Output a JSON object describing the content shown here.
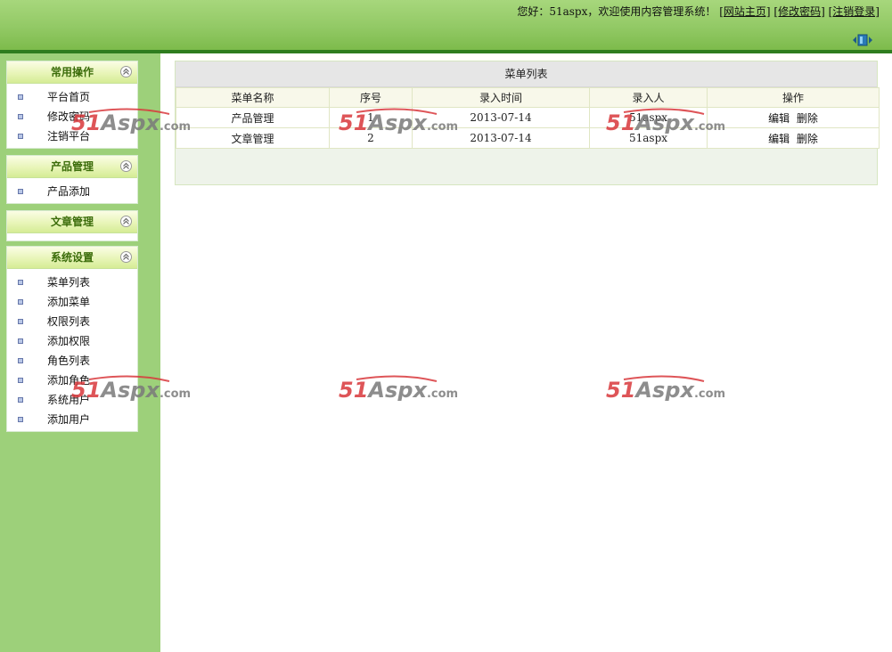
{
  "header": {
    "greeting_prefix": "您好：",
    "username": "51aspx",
    "greeting_suffix": "，欢迎使用内容管理系统！",
    "links": [
      "[网站主页]",
      "[修改密码]",
      "[注销登录]"
    ],
    "toggle_icon": "panel-toggle-icon"
  },
  "sidebar": {
    "groups": [
      {
        "title": "常用操作",
        "items": [
          "平台首页",
          "修改密码",
          "注销平台"
        ]
      },
      {
        "title": "产品管理",
        "items": [
          "产品添加"
        ]
      },
      {
        "title": "文章管理",
        "items": []
      },
      {
        "title": "系统设置",
        "items": [
          "菜单列表",
          "添加菜单",
          "权限列表",
          "添加权限",
          "角色列表",
          "添加角色",
          "系统用户",
          "添加用户"
        ]
      }
    ]
  },
  "main": {
    "title": "菜单列表",
    "columns": [
      "菜单名称",
      "序号",
      "录入时间",
      "录入人",
      "操作"
    ],
    "rows": [
      {
        "name": "产品管理",
        "order": "1",
        "date": "2013-07-14",
        "author": "51aspx",
        "edit": "编辑",
        "delete": "删除"
      },
      {
        "name": "文章管理",
        "order": "2",
        "date": "2013-07-14",
        "author": "51aspx",
        "edit": "编辑",
        "delete": "删除"
      }
    ]
  },
  "watermark": {
    "text_51": "51",
    "text_aspx": "Aspx",
    "text_com": ".com",
    "color_51": "#d9383c",
    "color_aspx": "#7a7a7a"
  },
  "colors": {
    "header_green": "#92c965",
    "header_dark_bar": "#2e7d1f",
    "sidebar_green": "#9dd07a",
    "menu_title": "#3c6d0b"
  }
}
